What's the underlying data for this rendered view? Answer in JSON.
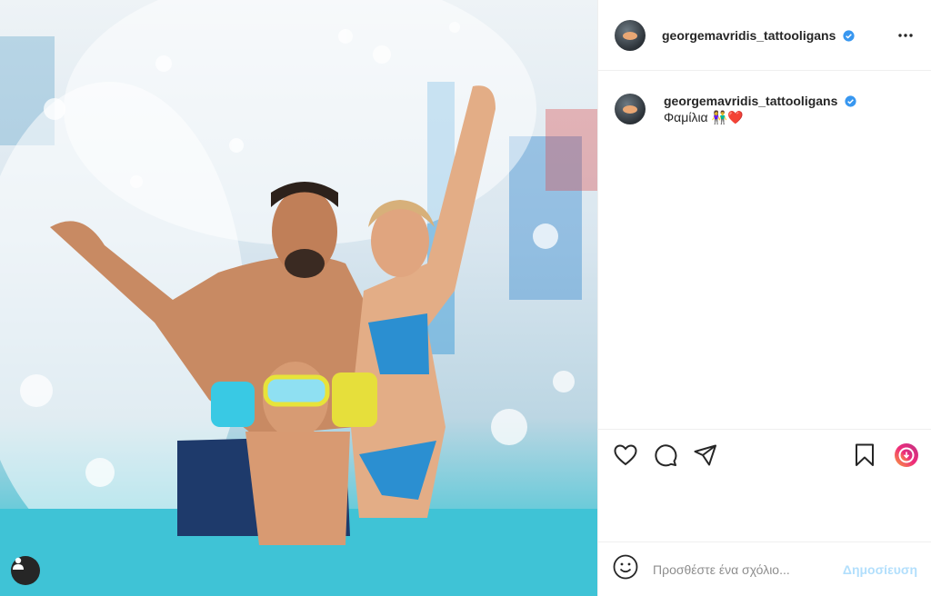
{
  "header": {
    "username": "georgemavridis_tattooligans",
    "verified": true,
    "more_icon": "more-horizontal-icon"
  },
  "caption": {
    "username": "georgemavridis_tattooligans",
    "text": "Φαμίλια 👫❤️"
  },
  "actions": {
    "like_icon": "heart-icon",
    "comment_icon": "comment-icon",
    "share_icon": "paper-plane-icon",
    "save_icon": "bookmark-icon",
    "extra_icon": "igtv-badge-icon"
  },
  "comment": {
    "emoji_icon": "smiley-icon",
    "placeholder": "Προσθέστε ένα σχόλιο...",
    "post_label": "Δημοσίευση"
  },
  "media": {
    "tag_icon": "user-tag-icon"
  },
  "colors": {
    "accent": "#0095f6",
    "post_disabled": "#b2dffc",
    "border": "#efefef"
  }
}
